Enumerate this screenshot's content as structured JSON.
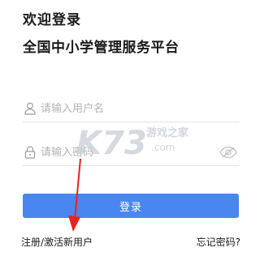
{
  "header": {
    "welcome_title": "欢迎登录",
    "platform_name": "全国中小学管理服务平台"
  },
  "form": {
    "username_placeholder": "请输入用户名",
    "password_placeholder": "请输入密码",
    "login_label": "登录"
  },
  "footer": {
    "register_label": "注册/激活新用户",
    "forgot_label": "忘记密码?"
  },
  "watermark": {
    "logo_text": "K73",
    "site_name": "游戏之家",
    "domain": ".com"
  },
  "icons": {
    "username": "user-icon",
    "password": "lock-icon",
    "toggle": "eye-icon"
  },
  "colors": {
    "accent": "#4a86f0",
    "annotation_arrow": "#e8231f",
    "text": "#1a1a1a",
    "placeholder": "#b3b3b3"
  }
}
